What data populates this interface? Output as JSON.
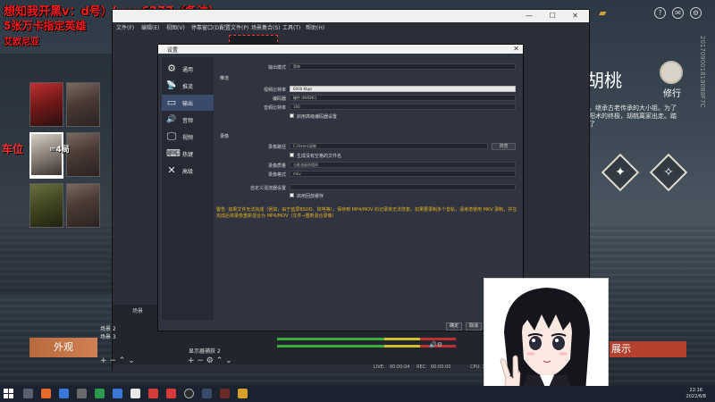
{
  "stream_overlay": {
    "line1": "想知我开黑v：d号）hmn6277（备注）",
    "line2": "5张万卡指定英雄",
    "line3": "艾欧尼亚",
    "seat_label": "车位",
    "seat_count": "=4局"
  },
  "game": {
    "character_name": "胡桃",
    "btn_repair": "修行",
    "btn_outlook": "外观",
    "btn_show": "展示",
    "desc_text": "师。继承古老传承的大小姐。为了保阳术的终极，胡桃离家出走。踏上了",
    "vertical_code": "2017090018180B8F7C"
  },
  "obs": {
    "menu": [
      "文件(F)",
      "编辑(E)",
      "视图(V)",
      "停靠窗口(D)",
      "配置文件(P)",
      "场景集合(S)",
      "工具(T)",
      "帮助(H)"
    ],
    "scenes_title": "场景",
    "scenes": [
      "场景 2",
      "场景 3"
    ],
    "source_item": "显示器捕获 2",
    "status": {
      "rec_label": "REC:",
      "rec_time": "00:00:00",
      "live_label": "LIVE:",
      "live_time": "00:00:04",
      "cpu": "CPU: 3.4%, 30.00 fps"
    }
  },
  "settings": {
    "title": "设置",
    "nav": [
      {
        "label": "通用",
        "icon": "gear-icon",
        "glyph": "⚙"
      },
      {
        "label": "推流",
        "icon": "antenna-icon",
        "glyph": "📡"
      },
      {
        "label": "输出",
        "icon": "output-icon",
        "glyph": "▭"
      },
      {
        "label": "音频",
        "icon": "speaker-icon",
        "glyph": "🔊"
      },
      {
        "label": "视频",
        "icon": "monitor-icon",
        "glyph": "🖵"
      },
      {
        "label": "热键",
        "icon": "keyboard-icon",
        "glyph": "⌨"
      },
      {
        "label": "高级",
        "icon": "tools-icon",
        "glyph": "✕"
      }
    ],
    "output_mode_label": "输出模式",
    "output_mode_value": "简单",
    "stream_section": "推流",
    "video_bitrate_label": "视频比特率",
    "video_bitrate_value": "6000 Kbps",
    "encoder_label": "编码器",
    "encoder_value": "硬件 (NVENC)",
    "audio_bitrate_label": "音频比特率",
    "audio_bitrate_value": "160",
    "advanced_encoder_label": "启用高级编码器设置",
    "recording_section": "录像",
    "rec_path_label": "录像路径",
    "rec_path_value": "C:/Users/录制",
    "browse_label": "浏览",
    "no_space_label": "生成没有空格的文件名",
    "rec_quality_label": "录像质量",
    "rec_quality_value": "与推流画质相同",
    "rec_format_label": "录像格式",
    "rec_format_value": "mkv",
    "muxer_label": "自定义混流器设置",
    "replay_buffer_label": "启用回放缓存",
    "warning_text": "警告: 如果文件无法完成（例如，由于蓝屏BSOD、掉电等），保存到 MP4/MOV 的记录将无法恢复。如果要录制多个音轨，请考虑使用 MKV 录制，并在完成后将录像重新混合为 MP4/MOV（文件→重新混合录像）",
    "ok_label": "确定",
    "cancel_label": "取消"
  },
  "taskbar": {
    "time": "22:16",
    "date": "2022/6/8"
  }
}
